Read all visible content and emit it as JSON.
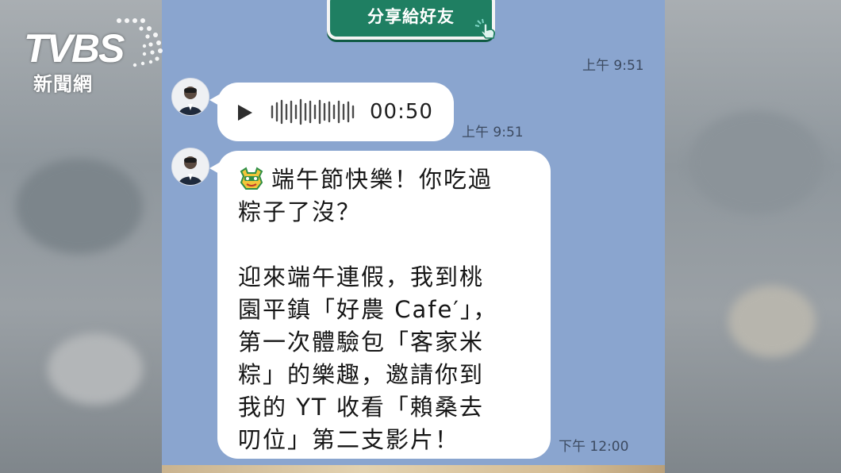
{
  "share_button": {
    "label": "分享給好友"
  },
  "messages": {
    "top_time": "上午 9:51",
    "voice": {
      "duration": "00:50",
      "time": "上午 9:51"
    },
    "text_message": {
      "lines": [
        "端午節快樂！你吃過",
        "粽子了沒？",
        "",
        "迎來端午連假，我到桃",
        "園平鎮「好農 Cafe′」，",
        "第一次體驗包「客家米",
        "粽」的樂趣，邀請你到",
        "我的 YT 收看「賴桑去",
        "叨位」第二支影片！"
      ],
      "time": "下午 12:00"
    }
  },
  "logo": {
    "brand": "TVBS",
    "subtitle": "新聞網"
  },
  "icons": {
    "play": "play-icon",
    "tap": "tap-hand-icon",
    "dragon": "dragon-emoji-icon",
    "avatar": "avatar"
  },
  "colors": {
    "chat_bg": "#8aa5cf",
    "share_button": "#1f7f62",
    "bubble": "#ffffff"
  }
}
